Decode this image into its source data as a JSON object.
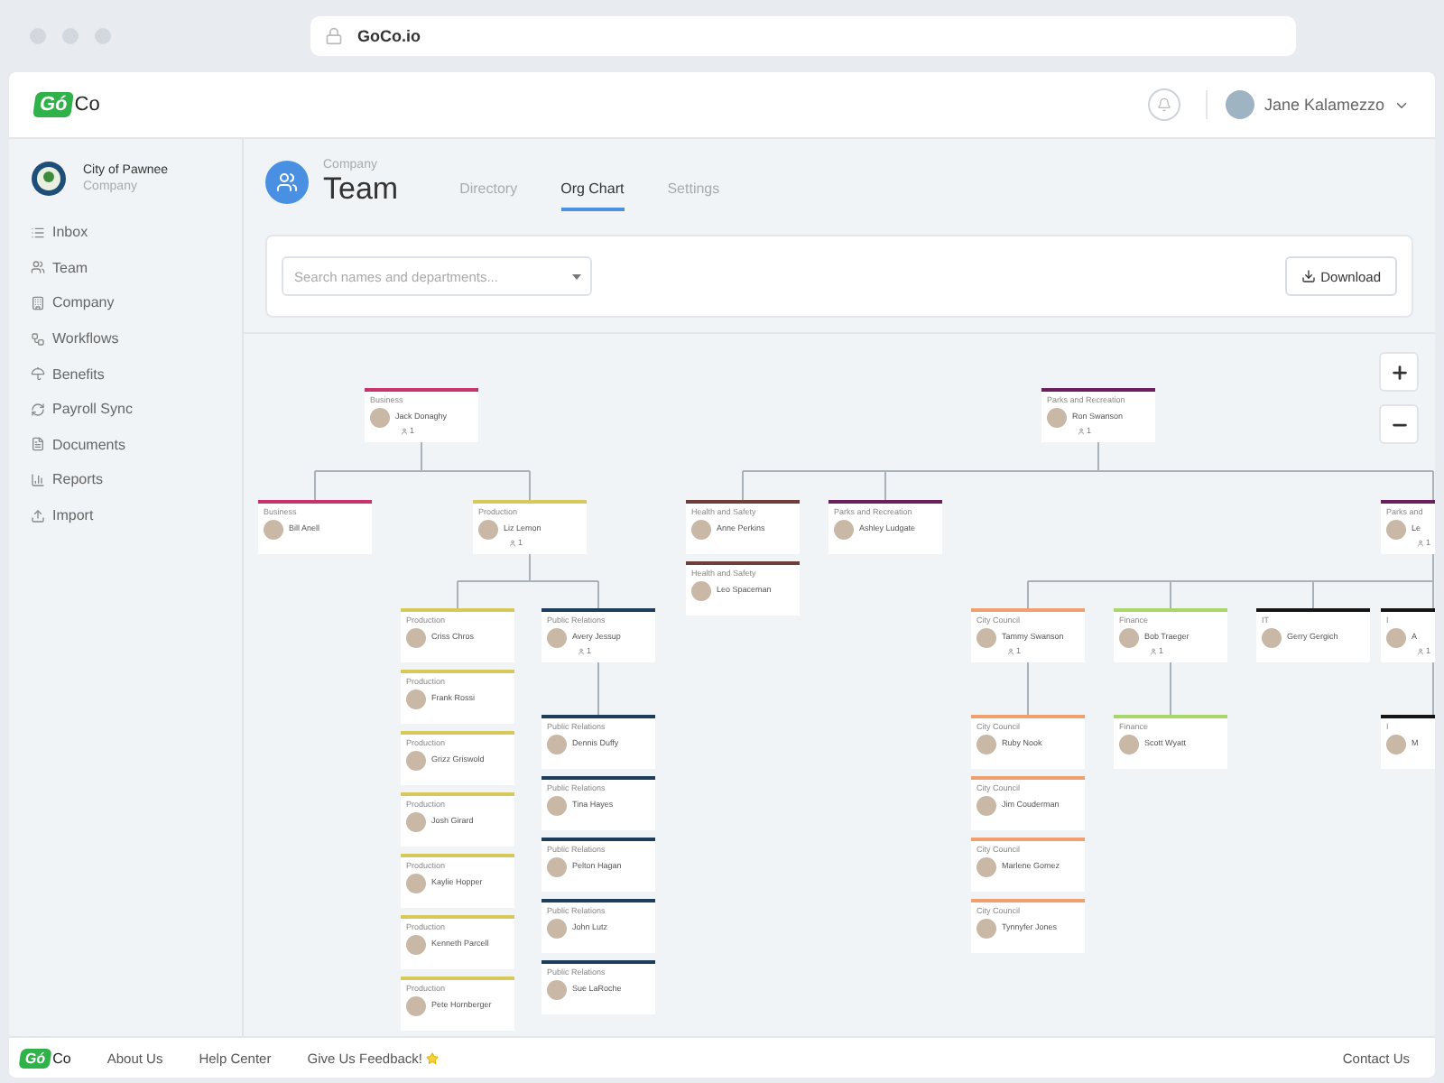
{
  "browser": {
    "url": "GoCo.io"
  },
  "header": {
    "logo": {
      "first": "Gó",
      "second": "Co"
    },
    "user": "Jane Kalamezzo"
  },
  "sidebar": {
    "org_name": "City of Pawnee",
    "org_type": "Company",
    "items": [
      "Inbox",
      "Team",
      "Company",
      "Workflows",
      "Benefits",
      "Payroll Sync",
      "Documents",
      "Reports",
      "Import"
    ]
  },
  "page": {
    "section": "Company",
    "title": "Team",
    "tabs": [
      {
        "label": "Directory",
        "selected": false
      },
      {
        "label": "Org Chart",
        "selected": true
      },
      {
        "label": "Settings",
        "selected": false
      }
    ]
  },
  "toolbar": {
    "search": {
      "placeholder": "Search names and departments..."
    },
    "download": "Download"
  },
  "org_chart": {
    "nodes": [
      {
        "department": "Business",
        "name": "Jack Donaghy",
        "reports": "1",
        "color": "#c8336e",
        "children": [
          {
            "department": "Business",
            "name": "Bill Anell",
            "color": "#c8336e"
          },
          {
            "department": "Production",
            "name": "Liz Lemon",
            "reports": "1",
            "color": "#d6c85a",
            "children": [
              {
                "department": "Production",
                "name": "Criss Chros",
                "color": "#d6c85a"
              },
              {
                "department": "Production",
                "name": "Frank Rossi",
                "color": "#d6c85a"
              },
              {
                "department": "Production",
                "name": "Grizz Griswold",
                "color": "#d6c85a"
              },
              {
                "department": "Production",
                "name": "Josh Girard",
                "color": "#d6c85a"
              },
              {
                "department": "Production",
                "name": "Kaylie Hopper",
                "color": "#d6c85a"
              },
              {
                "department": "Production",
                "name": "Kenneth Parcell",
                "color": "#d6c85a"
              },
              {
                "department": "Production",
                "name": "Pete Hornberger",
                "color": "#d6c85a"
              },
              {
                "department": "Public Relations",
                "name": "Avery Jessup",
                "reports": "1",
                "color": "#1e3d5c",
                "children": [
                  {
                    "department": "Public Relations",
                    "name": "Dennis Duffy",
                    "color": "#1e3d5c"
                  },
                  {
                    "department": "Public Relations",
                    "name": "Tina Hayes",
                    "color": "#1e3d5c"
                  },
                  {
                    "department": "Public Relations",
                    "name": "Pelton Hagan",
                    "color": "#1e3d5c"
                  },
                  {
                    "department": "Public Relations",
                    "name": "John Lutz",
                    "color": "#1e3d5c"
                  },
                  {
                    "department": "Public Relations",
                    "name": "Sue LaRoche",
                    "color": "#1e3d5c"
                  }
                ]
              }
            ]
          }
        ]
      },
      {
        "department": "Parks and Recreation",
        "name": "Ron Swanson",
        "reports": "1",
        "color": "#6b1f5e",
        "children": [
          {
            "department": "Health and Safety",
            "name": "Anne Perkins",
            "color": "#6e3f3a"
          },
          {
            "department": "Health and Safety",
            "name": "Leo Spaceman",
            "color": "#6e3f3a"
          },
          {
            "department": "Parks and Recreation",
            "name": "Ashley Ludgate",
            "color": "#6b1f5e"
          },
          {
            "department": "Parks and",
            "name": "Le",
            "reports": "1",
            "color": "#6b1f5e",
            "children": [
              {
                "department": "City Council",
                "name": "Tammy Swanson",
                "reports": "1",
                "color": "#f0a06e",
                "children": [
                  {
                    "department": "City Council",
                    "name": "Ruby Nook",
                    "color": "#f0a06e"
                  },
                  {
                    "department": "City Council",
                    "name": "Jim Couderman",
                    "color": "#f0a06e"
                  },
                  {
                    "department": "City Council",
                    "name": "Marlene Gomez",
                    "color": "#f0a06e"
                  },
                  {
                    "department": "City Council",
                    "name": "Tynnyfer Jones",
                    "color": "#f0a06e"
                  }
                ]
              },
              {
                "department": "Finance",
                "name": "Bob Traeger",
                "reports": "1",
                "color": "#a9d66b",
                "children": [
                  {
                    "department": "Finance",
                    "name": "Scott Wyatt",
                    "color": "#a9d66b"
                  }
                ]
              },
              {
                "department": "IT",
                "name": "Gerry Gergich",
                "color": "#151515"
              },
              {
                "department": "I",
                "name": "A",
                "reports": "1",
                "color": "#151515",
                "children": [
                  {
                    "department": "I",
                    "name": "M",
                    "color": "#151515"
                  }
                ]
              }
            ]
          }
        ]
      }
    ]
  },
  "footer": {
    "logo": {
      "first": "Gó",
      "second": "Co"
    },
    "links": [
      "About Us",
      "Help Center",
      "Give Us Feedback!"
    ],
    "contact": "Contact Us"
  }
}
